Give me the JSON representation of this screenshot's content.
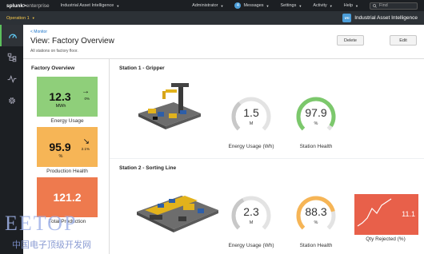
{
  "topbar": {
    "brand_main": "splunk>",
    "brand_ent": "enterprise",
    "app_menu": "Industrial Asset Intelligence",
    "administrator": "Administrator",
    "messages_count": "4",
    "messages": "Messages",
    "settings": "Settings",
    "activity": "Activity",
    "help": "Help",
    "find_placeholder": "Find"
  },
  "appbar": {
    "operation": "Operation 1",
    "app_logo": "IAI",
    "app_title": "Industrial Asset Intelligence"
  },
  "header": {
    "breadcrumb": "< Monitor",
    "title": "View: Factory Overview",
    "subtitle": "All stations on factory floor.",
    "delete_label": "Delete",
    "edit_label": "Edit"
  },
  "overview": {
    "title": "Factory Overview",
    "tiles": [
      {
        "value": "12.3",
        "unit": "MWh",
        "arrow": "→",
        "change": "0%",
        "label": "Energy Usage",
        "color": "#8fcf7a"
      },
      {
        "value": "95.9",
        "unit": "%",
        "arrow": "↘",
        "change": "2.1%",
        "label": "Production Health",
        "color": "#f6b556"
      },
      {
        "value": "121.2",
        "unit": "",
        "arrow": "",
        "change": "",
        "label": "Total Production",
        "color": "#ee7a4e"
      }
    ]
  },
  "stations": [
    {
      "title": "Station 1 - Gripper",
      "gauges": [
        {
          "value": "1.5",
          "fraction": 0.35,
          "unit": "M",
          "label": "Energy Usage (Wh)",
          "color": "#c8c8c8"
        },
        {
          "value": "97.9",
          "fraction": 0.95,
          "unit": "%",
          "label": "Station Health",
          "color": "#7cc86c"
        }
      ]
    },
    {
      "title": "Station 2 - Sorting Line",
      "gauges": [
        {
          "value": "2.3",
          "fraction": 0.4,
          "unit": "M",
          "label": "Energy Usage (Wh)",
          "color": "#c8c8c8"
        },
        {
          "value": "88.3",
          "fraction": 0.78,
          "unit": "%",
          "label": "Station Health",
          "color": "#f6b556"
        }
      ],
      "sparkline": {
        "value": "11.1",
        "label": "Qty Rejected (%)",
        "color": "#e8604a"
      }
    }
  ],
  "watermark": {
    "main": "EETOP",
    "sub": "中国电子顶级开发网"
  }
}
